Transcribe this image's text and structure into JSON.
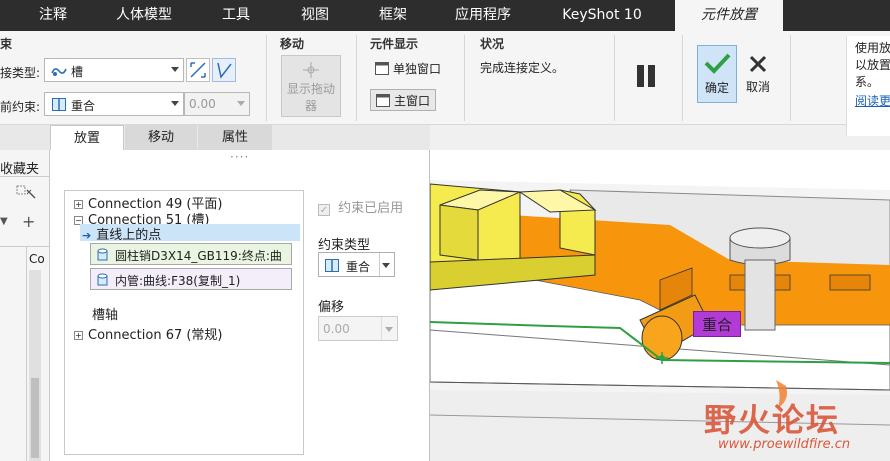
{
  "tabs": [
    {
      "label": "注释"
    },
    {
      "label": "人体模型"
    },
    {
      "label": "工具"
    },
    {
      "label": "视图"
    },
    {
      "label": "框架"
    },
    {
      "label": "应用程序"
    },
    {
      "label": "KeyShot 10"
    },
    {
      "label": "元件放置"
    }
  ],
  "ribbon": {
    "left_group_title": "束",
    "connection_type_label": "接类型:",
    "connection_type_value": "槽",
    "constraint_label": "前约束:",
    "constraint_value": "重合",
    "offset_value": "0.00",
    "move_group_title": "移动",
    "show_drag_label_1": "显示拖动",
    "show_drag_label_2": "器",
    "display_group_title": "元件显示",
    "separate_window_label": "单独窗口",
    "main_window_label": "主窗口",
    "status_group_title": "状况",
    "status_text": "完成连接定义。",
    "ok_label": "确定",
    "cancel_label": "取消",
    "help_line1": "使用放",
    "help_line2": "以放置",
    "help_line3": "系。",
    "help_link": "阅读更"
  },
  "subtabs": [
    {
      "label": "放置"
    },
    {
      "label": "移动"
    },
    {
      "label": "属性"
    }
  ],
  "left_pane": {
    "title": "收藏夹",
    "col_header": "Co"
  },
  "tree": {
    "conn49": "Connection 49 (平面)",
    "conn51": "Connection 51 (槽)",
    "point_on_line": "直线上的点",
    "ref1": "圆柱销D3X14_GB119:终点:曲",
    "ref2": "内管:曲线:F38(复制_1)",
    "slot_axis": "槽轴",
    "conn67": "Connection 67 (常规)"
  },
  "constraint_panel": {
    "enabled_label": "约束已启用",
    "type_label": "约束类型",
    "type_value": "重合",
    "offset_label": "偏移",
    "offset_value": "0.00"
  },
  "viewport": {
    "tag_label": "重合",
    "watermark_main": "野火论坛",
    "watermark_url": "www.proewildfire.cn"
  },
  "colors": {
    "tabbar": "#2d2d2d",
    "accent_green": "#2ea043",
    "yellow_part": "#f5ea4e",
    "orange_part": "#f7950d",
    "tag_bg": "#b23ad6",
    "selected_row": "#cce4f7"
  }
}
